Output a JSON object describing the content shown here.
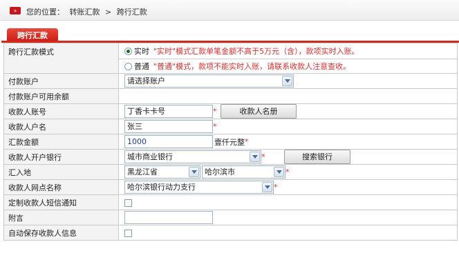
{
  "breadcrumb": {
    "icon": "arrow-icon",
    "prefix": "您的位置：",
    "level1": "转账汇款",
    "separator": ">",
    "level2": "跨行汇款"
  },
  "tab": {
    "label": "跨行汇款"
  },
  "colors": {
    "accent": "#cf2b20",
    "required": "#e03030"
  },
  "form": {
    "mode": {
      "label": "跨行汇款模式",
      "realtime_label": "实时",
      "realtime_note": "\"实时\"模式汇款单笔金额不高于5万元（含），款项实时入账。",
      "normal_label": "普通",
      "normal_note": "\"普通\"模式，款项不能实时入账，请联系收款人注意查收。",
      "selected": "实时"
    },
    "payer_account": {
      "label": "付款账户",
      "value": "请选择账户"
    },
    "available_balance": {
      "label": "付款账户可用余额",
      "value": ""
    },
    "payee_account": {
      "label": "收款人账号",
      "value": "丁香卡卡号",
      "required": "*",
      "button": "收款人名册"
    },
    "payee_name": {
      "label": "收款人户名",
      "value": "张三",
      "required": "*"
    },
    "amount": {
      "label": "汇款金额",
      "value": "1000",
      "amount_words": "壹仟元整",
      "required": "*"
    },
    "payee_bank": {
      "label": "收款人开户银行",
      "value": "城市商业银行",
      "required": "*",
      "button": "搜索银行"
    },
    "remit_location": {
      "label": "汇入地",
      "province": "黑龙江省",
      "city": "哈尔滨市",
      "required": "*"
    },
    "payee_branch": {
      "label": "收款人网点名称",
      "value": "哈尔滨银行动力支行",
      "required": "*"
    },
    "sms_notify": {
      "label": "定制收款人短信通知",
      "checked": false
    },
    "remarks": {
      "label": "附言",
      "value": ""
    },
    "auto_save": {
      "label": "自动保存收款人信息",
      "checked": false
    }
  }
}
